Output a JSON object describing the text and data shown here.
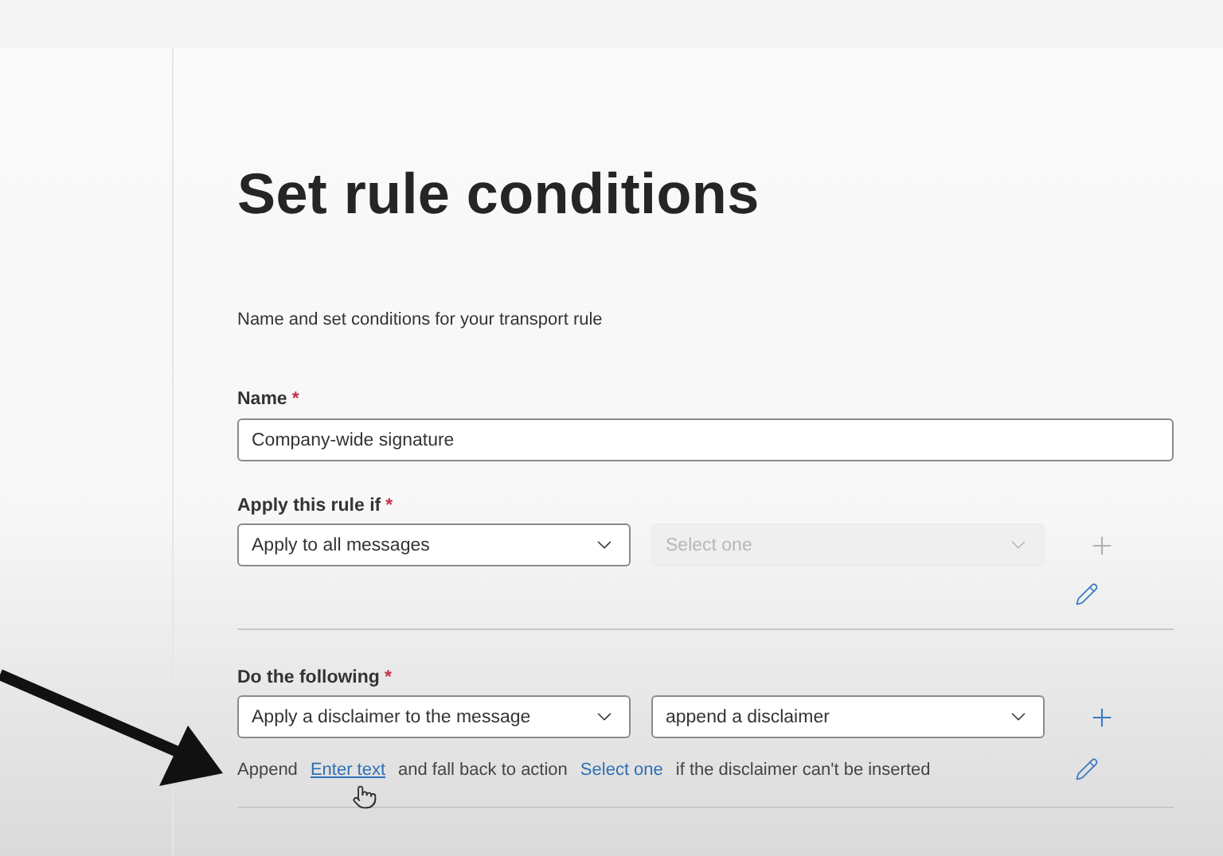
{
  "page": {
    "title": "Set rule conditions",
    "subtitle": "Name and set conditions for your transport rule"
  },
  "name_field": {
    "label": "Name",
    "asterisk": "*",
    "value": "Company-wide signature"
  },
  "conditions": [
    {
      "label": "Apply this rule if",
      "asterisk": "*",
      "selects": [
        {
          "value": "Apply to all messages",
          "disabled": false
        },
        {
          "placeholder": "Select one",
          "disabled": true
        }
      ],
      "add_disabled": true
    },
    {
      "label": "Do the following",
      "asterisk": "*",
      "selects": [
        {
          "value": "Apply a disclaimer to the message",
          "disabled": false
        },
        {
          "value": "append a disclaimer",
          "disabled": false
        }
      ],
      "add_disabled": false,
      "sentence": [
        {
          "kind": "text",
          "text": "Append"
        },
        {
          "kind": "link",
          "text": "Enter text",
          "underline": true
        },
        {
          "kind": "text",
          "text": "and fall back to action"
        },
        {
          "kind": "link",
          "text": "Select one",
          "underline": false
        },
        {
          "kind": "text",
          "text": "if the disclaimer can't be inserted"
        }
      ]
    }
  ]
}
